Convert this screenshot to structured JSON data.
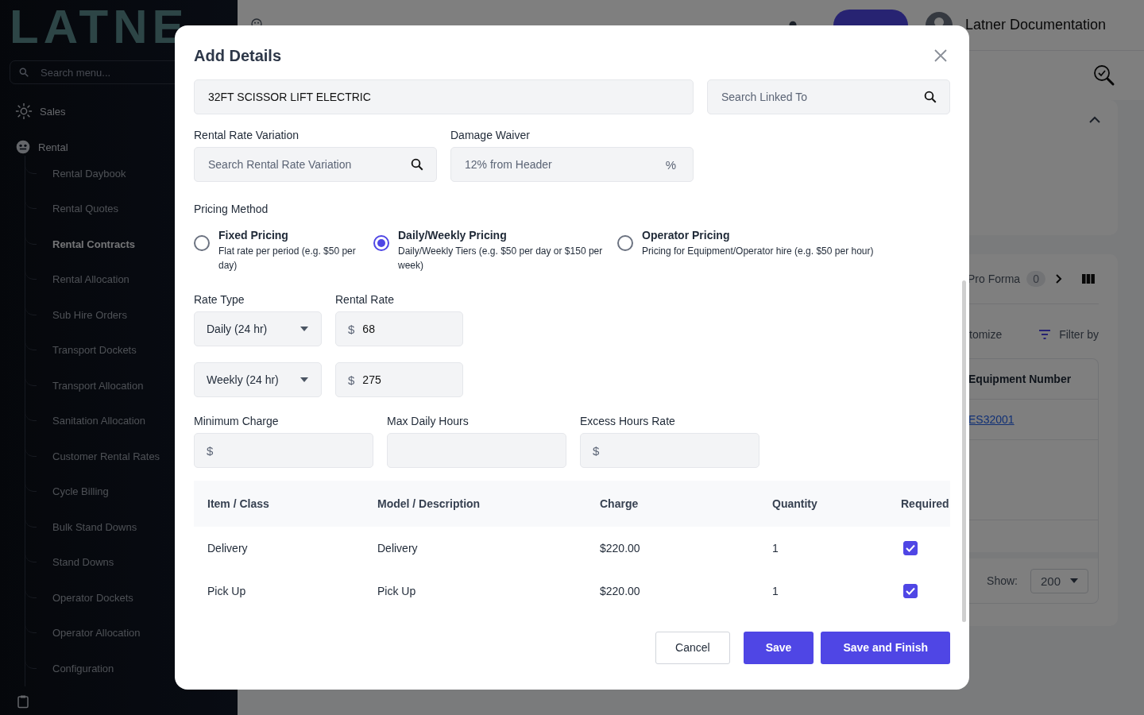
{
  "sidebar": {
    "logo": "LATNE",
    "search": {
      "placeholder": "Search menu..."
    },
    "items": [
      {
        "label": "Sales",
        "kind": "sales"
      },
      {
        "label": "Rental",
        "kind": "rental",
        "children": [
          {
            "label": "Rental Daybook",
            "selected": false
          },
          {
            "label": "Rental Quotes",
            "selected": false
          },
          {
            "label": "Rental Contracts",
            "selected": true
          },
          {
            "label": "Rental Allocation",
            "selected": false
          },
          {
            "label": "Sub Hire Orders",
            "selected": false
          },
          {
            "label": "Transport Dockets",
            "selected": false
          },
          {
            "label": "Transport Allocation",
            "selected": false
          },
          {
            "label": "Sanitation Allocation",
            "selected": false
          },
          {
            "label": "Customer Rental Rates",
            "selected": false
          },
          {
            "label": "Cycle Billing",
            "selected": false
          },
          {
            "label": "Bulk Stand Downs",
            "selected": false
          },
          {
            "label": "Stand Downs",
            "selected": false
          },
          {
            "label": "Operator Dockets",
            "selected": false
          },
          {
            "label": "Operator Allocation",
            "selected": false
          },
          {
            "label": "Configuration",
            "selected": false
          }
        ]
      }
    ]
  },
  "topbar": {
    "user": "Latner Documentation"
  },
  "background": {
    "tab": "Pro Forma",
    "tab_count": "0",
    "customize": "tomize",
    "filter": "Filter by",
    "table_column": "Equipment Number",
    "table_rows": [
      "ES32001"
    ],
    "show_label": "Show:",
    "show_value": "200"
  },
  "modal": {
    "title": "Add Details",
    "top_fields": [
      {
        "value": "32FT SCISSOR LIFT ELECTRIC"
      },
      {
        "placeholder": "Search Linked To"
      }
    ],
    "rental_rate_variation": {
      "label": "Rental Rate Variation",
      "placeholder": "Search Rental Rate Variation"
    },
    "damage_waiver": {
      "label": "Damage Waiver",
      "placeholder": "12% from Header",
      "suffix": "%"
    },
    "pricing_method": {
      "label": "Pricing Method",
      "options": [
        {
          "title": "Fixed Pricing",
          "description": "Flat rate per period (e.g. $50 per day)",
          "selected": false
        },
        {
          "title": "Daily/Weekly Pricing",
          "description": "Daily/Weekly Tiers (e.g. $50 per day or $150 per week)",
          "selected": true
        },
        {
          "title": "Operator Pricing",
          "description": "Pricing for Equipment/Operator hire (e.g. $50 per hour)",
          "selected": false
        }
      ]
    },
    "rates": {
      "rate_type_label": "Rate Type",
      "rental_rate_label": "Rental Rate",
      "rows": [
        {
          "rate_type": "Daily (24 hr)",
          "currency": "$",
          "rate": "68"
        },
        {
          "rate_type": "Weekly (24 hr)",
          "currency": "$",
          "rate": "275"
        }
      ]
    },
    "limits": [
      {
        "label": "Minimum Charge",
        "prefix": "$"
      },
      {
        "label": "Max Daily Hours"
      },
      {
        "label": "Excess Hours Rate",
        "prefix": "$"
      }
    ],
    "table": {
      "columns": [
        "Item / Class",
        "Model / Description",
        "Charge",
        "Quantity",
        "Required"
      ],
      "rows": [
        {
          "item": "Delivery",
          "model": "Delivery",
          "charge": "$220.00",
          "quantity": "1",
          "required": true
        },
        {
          "item": "Pick Up",
          "model": "Pick Up",
          "charge": "$220.00",
          "quantity": "1",
          "required": true
        }
      ]
    },
    "buttons": [
      {
        "label": "Cancel",
        "kind": "secondary"
      },
      {
        "label": "Save",
        "kind": "primary"
      },
      {
        "label": "Save and Finish",
        "kind": "primary"
      }
    ]
  }
}
